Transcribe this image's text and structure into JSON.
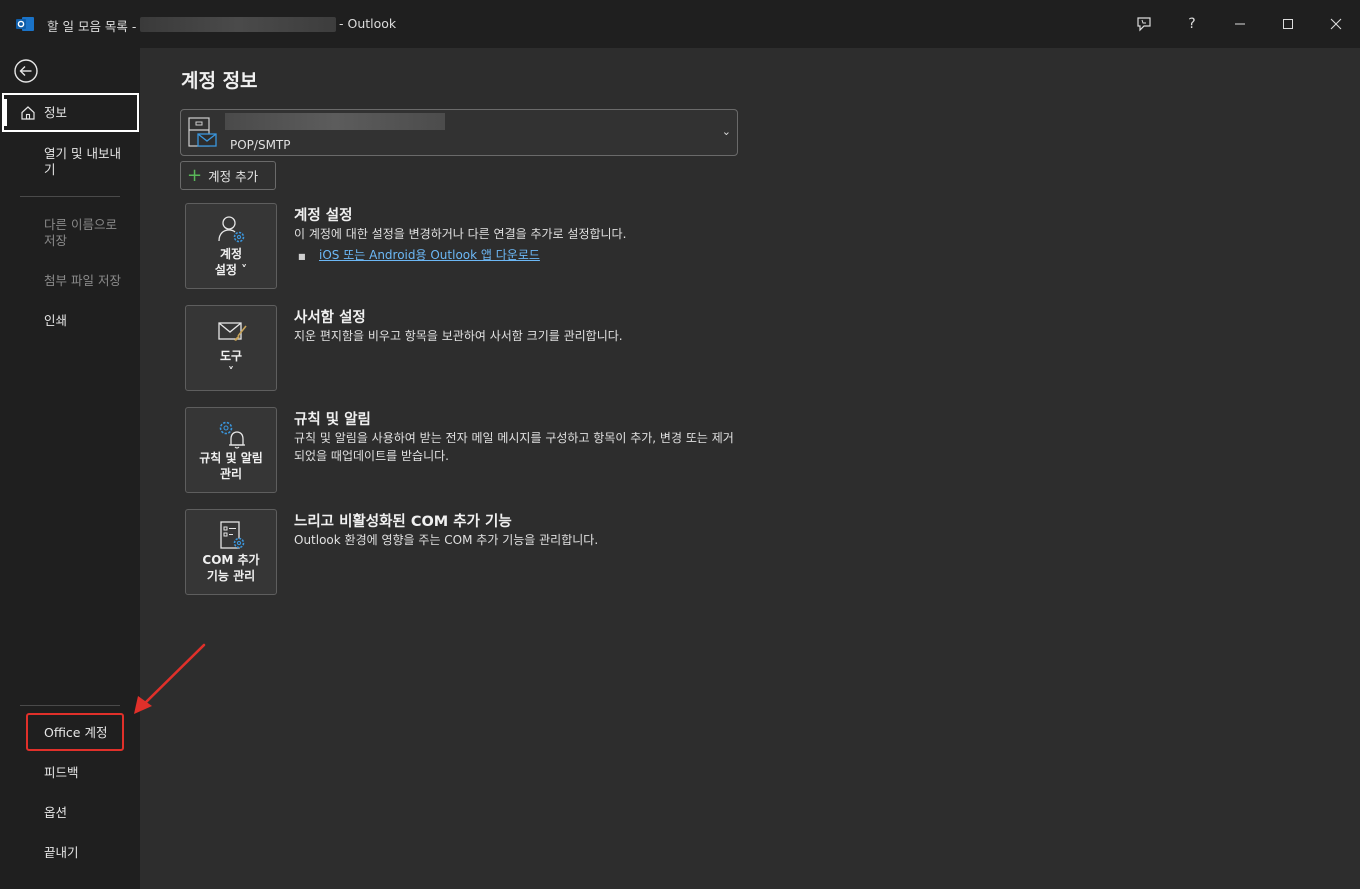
{
  "window": {
    "title_prefix": "할 일 모음 목록 -",
    "app_name": "- Outlook",
    "controls": {
      "help": "?"
    }
  },
  "sidebar": {
    "items": [
      {
        "label": "정보"
      },
      {
        "label": "열기 및 내보내기"
      },
      {
        "label": "다른 이름으로 저장"
      },
      {
        "label": "첨부 파일 저장"
      },
      {
        "label": "인쇄"
      },
      {
        "label": "Office 계정"
      },
      {
        "label": "피드백"
      },
      {
        "label": "옵션"
      },
      {
        "label": "끝내기"
      }
    ]
  },
  "main": {
    "page_title": "계정 정보",
    "account": {
      "type": "POP/SMTP"
    },
    "add_account_label": "계정 추가",
    "sections": [
      {
        "tile_label_1": "계정",
        "tile_label_2": "설정 ˅",
        "title": "계정 설정",
        "description": "이 계정에 대한 설정을 변경하거나 다른 연결을 추가로 설정합니다.",
        "link": "iOS 또는 Android용 Outlook 앱 다운로드"
      },
      {
        "tile_label_1": "도구",
        "tile_label_2": "˅",
        "title": "사서함 설정",
        "description": "지운 편지함을 비우고 항목을 보관하여 사서함 크기를 관리합니다."
      },
      {
        "tile_label_1": "규칙 및 알림",
        "tile_label_2": "관리",
        "title": "규칙 및 알림",
        "description": "규칙 및 알림을 사용하여 받는 전자 메일 메시지를 구성하고 항목이 추가, 변경 또는 제거되었을 때업데이트를 받습니다."
      },
      {
        "tile_label_1": "COM 추가",
        "tile_label_2": "기능 관리",
        "title": "느리고 비활성화된 COM 추가 기능",
        "description": "Outlook 환경에 영향을 주는 COM 추가 기능을 관리합니다."
      }
    ]
  },
  "colors": {
    "highlight": "#e0302a",
    "link": "#6cb8f6",
    "plus": "#59b859",
    "icon_accent": "#3a96dd"
  }
}
